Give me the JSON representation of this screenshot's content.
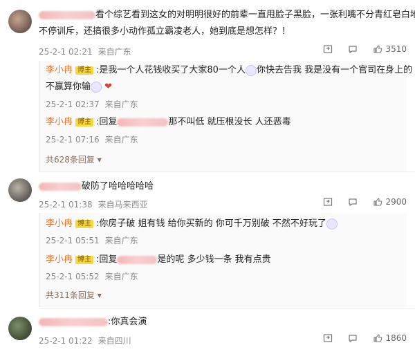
{
  "comments": [
    {
      "text": "看个综艺看到这女的对明明很好的前辈一直甩脸子黑脸，一张利嘴不分青红皂白地",
      "text2": "不停训斥，还搞很多小动作孤立霸凌老人，她到底是想怎样？！",
      "time": "25-2-1 02:21",
      "location": "来自广东",
      "likes": "3510",
      "replies": [
        {
          "name": "李小冉",
          "badge": "博主",
          "text": ":是我一个人花钱收买了大家80一个人",
          "text_b": "你快去告我 我是没有一个官司在身上的 告",
          "text2": "不赢算你输",
          "time": "25-2-1 02:37",
          "location": "来自广东"
        },
        {
          "name": "李小冉",
          "badge": "博主",
          "text": ":回复",
          "text_b": "那不叫低 就压根没长 人还恶毒",
          "time": "25-2-1 07:16",
          "location": "来自广东"
        }
      ],
      "more_replies": "共628条回复"
    },
    {
      "text": "破防了哈哈哈哈哈",
      "time": "25-2-1 01:38",
      "location": "来自马来西亚",
      "likes": "2900",
      "replies": [
        {
          "name": "李小冉",
          "badge": "博主",
          "text": ":你房子破 姐有钱 给你买新的 你可千万别破 不然不好玩了",
          "time": "25-2-1 05:51",
          "location": "来自广东"
        },
        {
          "name": "李小冉",
          "badge": "博主",
          "text": ":回复",
          "text_b": "是的呢 多少钱一条 我有点贵",
          "time": "25-2-1 05:52",
          "location": "来自广东"
        }
      ],
      "more_replies": "共311条回复"
    },
    {
      "text": ":你真会演",
      "time": "25-2-1 01:22",
      "location": "来自四川",
      "likes": "1860"
    }
  ],
  "colors": {
    "accent_name": "#e8742b",
    "heart": "#e23b3b",
    "badge_bg": "#f5d742"
  }
}
